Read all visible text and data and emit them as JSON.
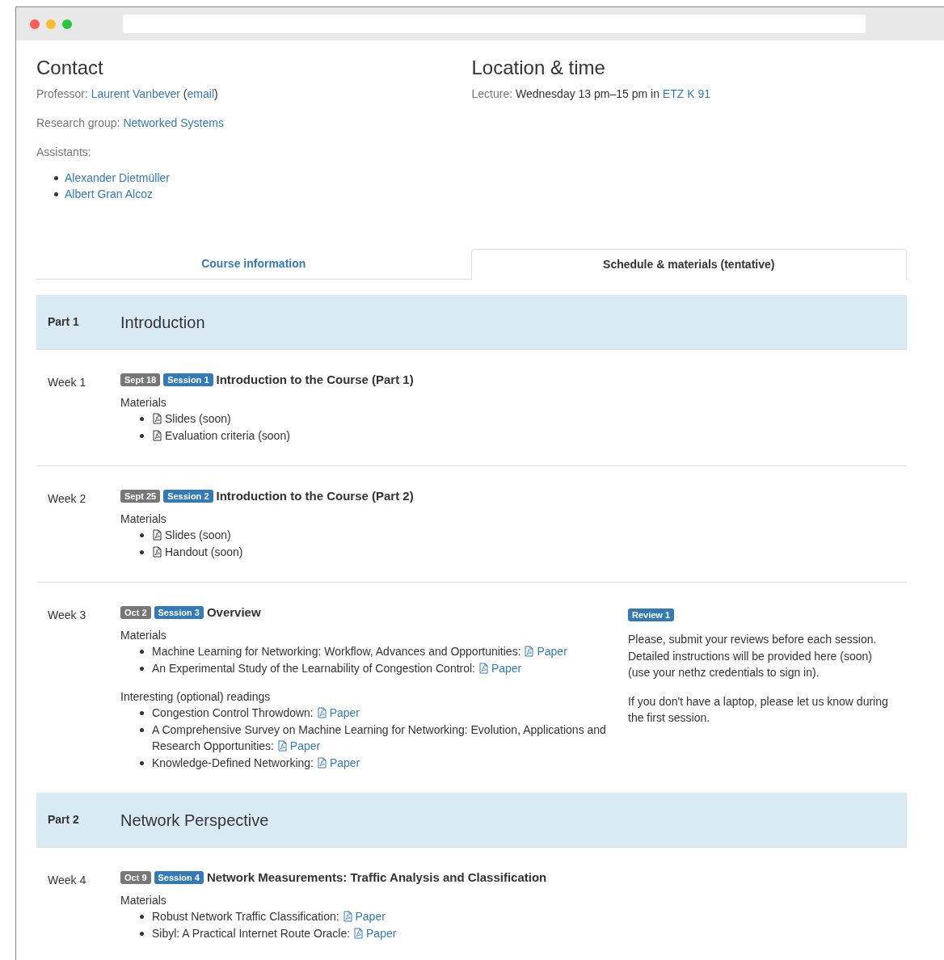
{
  "contact": {
    "title": "Contact",
    "lines": [
      [
        {
          "kind": "label",
          "text": "Professor: "
        },
        {
          "kind": "link",
          "text": "Laurent Vanbever"
        },
        {
          "kind": "text",
          "text": " ("
        },
        {
          "kind": "link",
          "text": "email"
        },
        {
          "kind": "text",
          "text": ")"
        }
      ],
      [
        {
          "kind": "label",
          "text": "Research group: "
        },
        {
          "kind": "link",
          "text": "Networked Systems"
        }
      ],
      [
        {
          "kind": "label",
          "text": "Assistants:"
        }
      ]
    ],
    "assistants": [
      "Alexander Dietmüller",
      "Albert Gran Alcoz"
    ]
  },
  "location": {
    "title": "Location & time",
    "lines": [
      [
        {
          "kind": "label",
          "text": "Lecture: "
        },
        {
          "kind": "text",
          "text": "Wednesday 13 pm–15 pm in "
        },
        {
          "kind": "link",
          "text": "ETZ K 91"
        }
      ]
    ]
  },
  "tabs": [
    {
      "label": "Course information",
      "selected": false
    },
    {
      "label": "Schedule & materials (tentative)",
      "selected": true
    }
  ],
  "parts": [
    {
      "label": "Part 1",
      "title": "Introduction",
      "weeks": [
        {
          "label": "Week 1",
          "date": "Sept 18",
          "session": "Session 1",
          "title": "Introduction to the Course (Part 1)",
          "groups": [
            {
              "heading": "Materials",
              "items": [
                {
                  "kind": "file",
                  "text": "Slides (soon)"
                },
                {
                  "kind": "file",
                  "text": "Evaluation criteria (soon)"
                }
              ]
            }
          ]
        },
        {
          "label": "Week 2",
          "date": "Sept 25",
          "session": "Session 2",
          "title": "Introduction to the Course (Part 2)",
          "groups": [
            {
              "heading": "Materials",
              "items": [
                {
                  "kind": "file",
                  "text": "Slides (soon)"
                },
                {
                  "kind": "file",
                  "text": "Handout (soon)"
                }
              ]
            }
          ]
        },
        {
          "label": "Week 3",
          "date": "Oct 2",
          "session": "Session 3",
          "title": "Overview",
          "groups": [
            {
              "heading": "Materials",
              "items": [
                {
                  "kind": "paper",
                  "text": "Machine Learning for Networking: Workflow, Advances and Opportunities:",
                  "link": "Paper"
                },
                {
                  "kind": "paper",
                  "text": "An Experimental Study of the Learnability of Congestion Control:",
                  "link": "Paper"
                }
              ]
            },
            {
              "heading": "Interesting (optional) readings",
              "items": [
                {
                  "kind": "paper",
                  "text": "Congestion Control Throwdown:",
                  "link": "Paper"
                },
                {
                  "kind": "paper",
                  "text": "A Comprehensive Survey on Machine Learning for Networking: Evolution, Applications and Research Opportunities:",
                  "link": "Paper"
                },
                {
                  "kind": "paper",
                  "text": "Knowledge-Defined Networking:",
                  "link": "Paper"
                }
              ]
            }
          ],
          "aside": {
            "badge": "Review 1",
            "paragraphs": [
              "Please, submit your reviews before each session. Detailed instructions will be provided here (soon) (use your nethz credentials to sign in).",
              "If you don't have a laptop, please let us know during the first session."
            ]
          }
        }
      ]
    },
    {
      "label": "Part 2",
      "title": "Network Perspective",
      "weeks": [
        {
          "label": "Week 4",
          "date": "Oct 9",
          "session": "Session 4",
          "title": "Network Measurements: Traffic Analysis and Classification",
          "groups": [
            {
              "heading": "Materials",
              "items": [
                {
                  "kind": "paper",
                  "text": "Robust Network Traffic Classification:",
                  "link": "Paper"
                },
                {
                  "kind": "paper",
                  "text": "Sibyl: A Practical Internet Route Oracle:",
                  "link": "Paper"
                }
              ]
            }
          ]
        }
      ]
    }
  ]
}
